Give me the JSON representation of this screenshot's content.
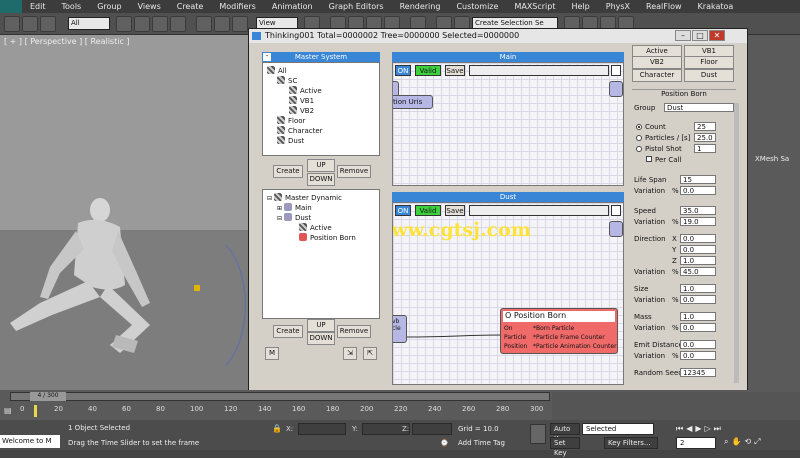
{
  "menu": [
    "Edit",
    "Tools",
    "Group",
    "Views",
    "Create",
    "Modifiers",
    "Animation",
    "Graph Editors",
    "Rendering",
    "Customize",
    "MAXScript",
    "Help",
    "PhysX",
    "RealFlow",
    "Krakatoa"
  ],
  "toolbar": {
    "selection_filter": "All",
    "ref_coord": "View",
    "create_selection_set": "Create Selection Se"
  },
  "viewport": {
    "label": "[ + ] [ Perspective ] [ Realistic ]"
  },
  "dialog": {
    "title": "Thinking001  Total=0000002  Tree=0000000  Selected=0000000",
    "master_system": {
      "header": "Master System",
      "tree": [
        "All",
        "SC",
        "Active",
        "VB1",
        "VB2",
        "Floor",
        "Character",
        "Dust"
      ],
      "btn_create": "Create",
      "btn_up": "UP",
      "btn_down": "DOWN",
      "btn_remove": "Remove"
    },
    "master_dynamic": {
      "tree": [
        "Master Dynamic",
        "Main",
        "Dust",
        "Active",
        "Position Born"
      ],
      "btn_create": "Create",
      "btn_up": "UP",
      "btn_down": "DOWN",
      "btn_remove": "Remove",
      "btn_m": "M"
    },
    "main_graph": {
      "header": "Main",
      "on": "ON",
      "valid": "Valid",
      "save": "Save",
      "node_text": "tion Uris"
    },
    "dust_graph": {
      "header": "Dust",
      "on": "ON",
      "valid": "Valid",
      "save": "Save",
      "watermark": "www.cgtsj.com",
      "node_small": [
        "vb",
        "cle"
      ],
      "node": {
        "title": "O Position Born",
        "rows": [
          [
            "On",
            "*Born Particle"
          ],
          [
            "Particle",
            "*Particle Frame Counter"
          ],
          [
            "Position",
            "*Particle Animation Counter"
          ]
        ]
      }
    },
    "props": {
      "top_buttons": [
        "Active",
        "VB1",
        "VB2",
        "Floor",
        "Character",
        "Dust"
      ],
      "section": "Position Born",
      "group_label": "Group",
      "group_value": "Dust",
      "count_label": "Count",
      "count_value": "25",
      "particles_label": "Particles  /  [s]",
      "particles_value": "25.0",
      "pistol_label": "Pistol Shot",
      "pistol_value": "1",
      "percall_label": "Per Call",
      "lifespan_label": "Life Span",
      "lifespan_value": "15",
      "variation_label": "Variation",
      "pct": "%",
      "lifespan_var": "0.0",
      "speed_label": "Speed",
      "speed_value": "35.0",
      "speed_var": "19.0",
      "direction_label": "Direction",
      "x": "X",
      "y": "Y",
      "z": "Z",
      "dir_x": "0.0",
      "dir_y": "0.0",
      "dir_z": "1.0",
      "dir_var": "45.0",
      "size_label": "Size",
      "size_value": "1.0",
      "size_var": "0.0",
      "mass_label": "Mass",
      "mass_value": "1.0",
      "mass_var": "0.0",
      "emit_label": "Emit Distance",
      "emit_value": "0.0",
      "emit_var": "0.0",
      "seed_label": "Random Seed",
      "seed_value": "12345"
    }
  },
  "cmdpanel": {
    "label": "XMesh Sa"
  },
  "timeline": {
    "frame": "4 / 300",
    "ticks": [
      "0",
      "20",
      "40",
      "60",
      "80",
      "100",
      "120",
      "140",
      "160",
      "180",
      "200",
      "220",
      "240",
      "260",
      "280",
      "300"
    ]
  },
  "status": {
    "welcome": "Welcome to M",
    "selected": "1 Object Selected",
    "hint": "Drag the Time Slider to set the frame",
    "x": "X:",
    "y": "Y:",
    "z": "Z:",
    "grid": "Grid = 10.0",
    "add_time_tag": "Add Time Tag",
    "auto_key": "Auto Key",
    "auto_key_value": "Selected",
    "set_key": "Set Key",
    "key_filters": "Key Filters...",
    "frame_field": "2"
  }
}
